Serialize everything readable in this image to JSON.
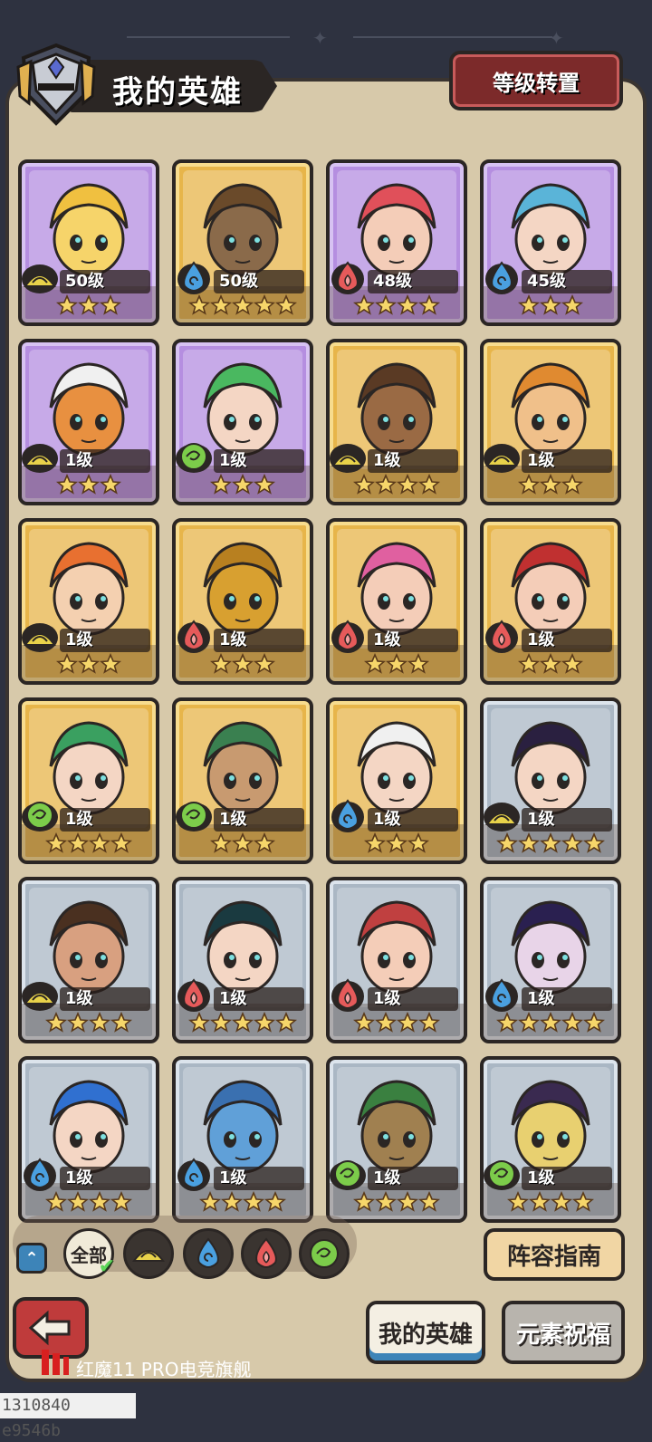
{
  "header": {
    "title": "我的英雄",
    "level_transfer_label": "等级转置"
  },
  "colors": {
    "card_purple": "#b58ee0",
    "card_gold": "#e7b54a",
    "card_silver": "#aab7c4",
    "element_earth": "#e8d24a",
    "element_water": "#4aa0e0",
    "element_fire": "#e65a5a",
    "element_wind": "#7ccc4a"
  },
  "heroes": [
    {
      "level": "50级",
      "element": "earth",
      "stars": 3,
      "rarity": "purple",
      "skin": "#f6d46a",
      "hair": "#f0c040"
    },
    {
      "level": "50级",
      "element": "water",
      "stars": 5,
      "rarity": "gold",
      "skin": "#8a6a4a",
      "hair": "#6a4a2a"
    },
    {
      "level": "48级",
      "element": "fire",
      "stars": 4,
      "rarity": "purple",
      "skin": "#f4cdb8",
      "hair": "#e0505a"
    },
    {
      "level": "45级",
      "element": "water",
      "stars": 3,
      "rarity": "purple",
      "skin": "#f4d6c4",
      "hair": "#5ab4d8"
    },
    {
      "level": "1级",
      "element": "earth",
      "stars": 3,
      "rarity": "purple",
      "skin": "#e89040",
      "hair": "#f0f0f0"
    },
    {
      "level": "1级",
      "element": "wind",
      "stars": 3,
      "rarity": "purple",
      "skin": "#f4d6c4",
      "hair": "#4ab860"
    },
    {
      "level": "1级",
      "element": "earth",
      "stars": 4,
      "rarity": "gold",
      "skin": "#9a6a44",
      "hair": "#5a3a24"
    },
    {
      "level": "1级",
      "element": "earth",
      "stars": 3,
      "rarity": "gold",
      "skin": "#f0c08a",
      "hair": "#e08a30"
    },
    {
      "level": "1级",
      "element": "earth",
      "stars": 3,
      "rarity": "gold",
      "skin": "#f4d0b0",
      "hair": "#e87030"
    },
    {
      "level": "1级",
      "element": "fire",
      "stars": 3,
      "rarity": "gold",
      "skin": "#d8a030",
      "hair": "#b88020"
    },
    {
      "level": "1级",
      "element": "fire",
      "stars": 3,
      "rarity": "gold",
      "skin": "#f4cdb8",
      "hair": "#e060a0"
    },
    {
      "level": "1级",
      "element": "fire",
      "stars": 3,
      "rarity": "gold",
      "skin": "#f4cdb8",
      "hair": "#c03030"
    },
    {
      "level": "1级",
      "element": "wind",
      "stars": 4,
      "rarity": "gold",
      "skin": "#f4d6c4",
      "hair": "#3aa060"
    },
    {
      "level": "1级",
      "element": "wind",
      "stars": 3,
      "rarity": "gold",
      "skin": "#c89a70",
      "hair": "#3a8050"
    },
    {
      "level": "1级",
      "element": "water",
      "stars": 3,
      "rarity": "gold",
      "skin": "#f4d6c4",
      "hair": "#f0f0f0"
    },
    {
      "level": "1级",
      "element": "earth",
      "stars": 5,
      "rarity": "silver",
      "skin": "#f4d6c4",
      "hair": "#2a2040"
    },
    {
      "level": "1级",
      "element": "earth",
      "stars": 4,
      "rarity": "silver",
      "skin": "#d8a080",
      "hair": "#4a3020"
    },
    {
      "level": "1级",
      "element": "fire",
      "stars": 5,
      "rarity": "silver",
      "skin": "#f4d6c4",
      "hair": "#1a3a40"
    },
    {
      "level": "1级",
      "element": "fire",
      "stars": 4,
      "rarity": "silver",
      "skin": "#f4cdb8",
      "hair": "#c04040"
    },
    {
      "level": "1级",
      "element": "water",
      "stars": 5,
      "rarity": "silver",
      "skin": "#e8d4e8",
      "hair": "#2a2050"
    },
    {
      "level": "1级",
      "element": "water",
      "stars": 4,
      "rarity": "silver",
      "skin": "#f4d6c4",
      "hair": "#3070d0"
    },
    {
      "level": "1级",
      "element": "water",
      "stars": 4,
      "rarity": "silver",
      "skin": "#60a0d8",
      "hair": "#3a70b0"
    },
    {
      "level": "1级",
      "element": "wind",
      "stars": 4,
      "rarity": "silver",
      "skin": "#a08050",
      "hair": "#3a8040"
    },
    {
      "level": "1级",
      "element": "wind",
      "stars": 4,
      "rarity": "silver",
      "skin": "#e8d070",
      "hair": "#3a2a50"
    }
  ],
  "filters": {
    "all_label": "全部",
    "elements": [
      "earth-icon",
      "water-icon",
      "fire-icon",
      "wind-icon"
    ]
  },
  "guide_label": "阵容指南",
  "tabs": {
    "my_heroes": "我的英雄",
    "element_blessing": "元素祝福"
  },
  "device_caption": "红魔11 PRO电竞旗舰",
  "watermark": "1310840 e9546b"
}
